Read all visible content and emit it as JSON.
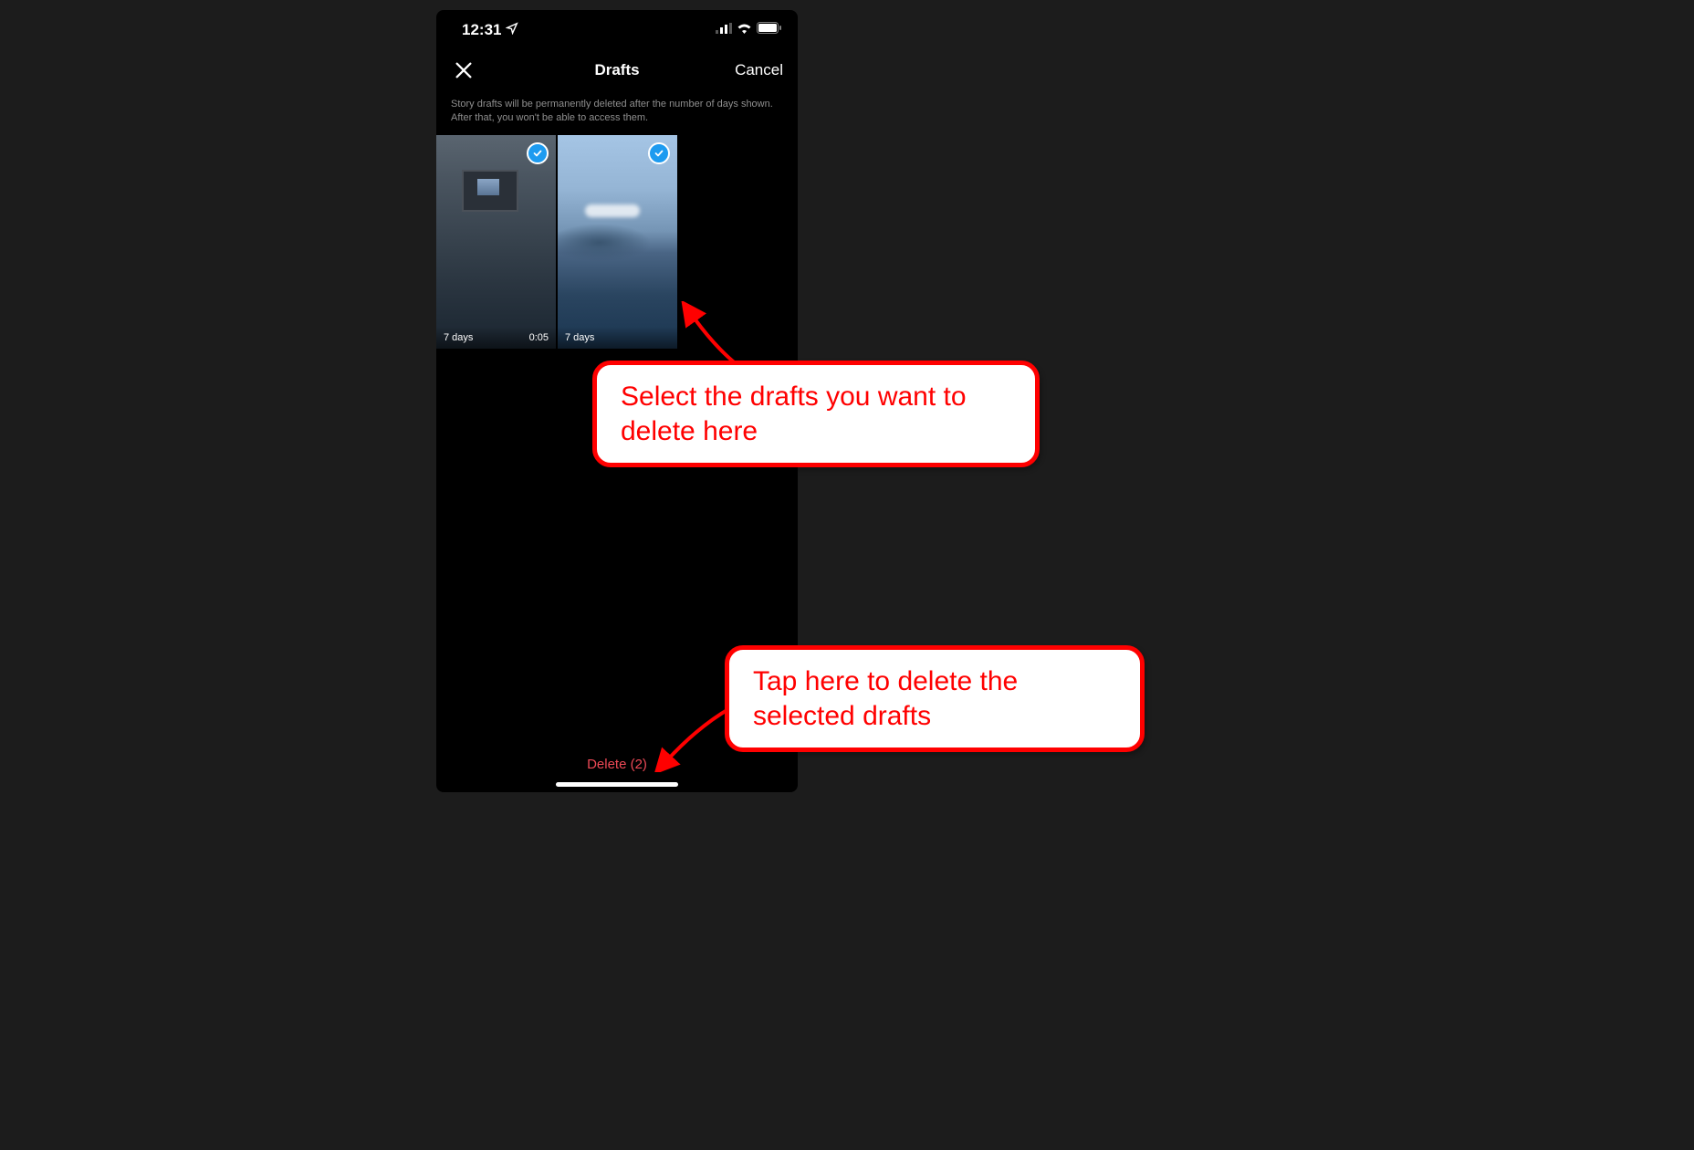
{
  "status": {
    "time": "12:31"
  },
  "nav": {
    "title": "Drafts",
    "cancel_label": "Cancel"
  },
  "info_text": "Story drafts will be permanently deleted after the number of days shown. After that, you won't be able to access them.",
  "drafts": [
    {
      "days_label": "7 days",
      "duration": "0:05",
      "selected": true
    },
    {
      "days_label": "7 days",
      "duration": "",
      "selected": true
    }
  ],
  "delete_label": "Delete (2)",
  "annotations": {
    "select_text": "Select the drafts you want to delete here",
    "delete_text": "Tap here to delete the selected drafts"
  }
}
